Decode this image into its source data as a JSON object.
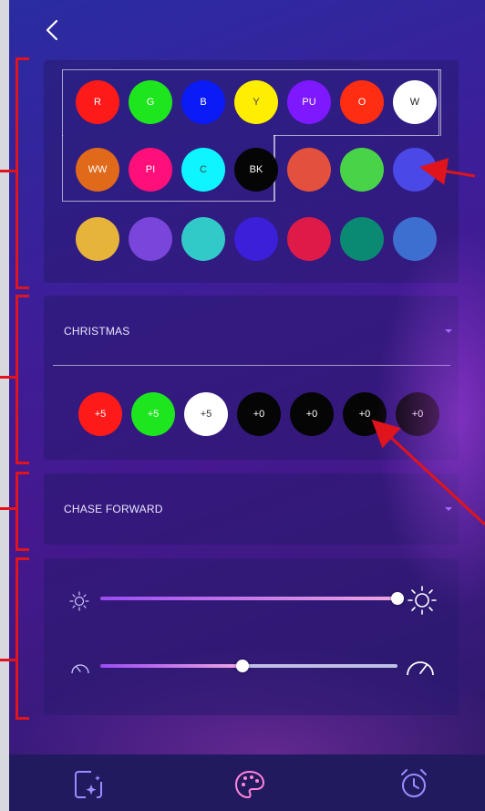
{
  "colors": {
    "row1": [
      {
        "label": "R",
        "bg": "#ff1a1a"
      },
      {
        "label": "G",
        "bg": "#1ee61e"
      },
      {
        "label": "B",
        "bg": "#0a1bf5"
      },
      {
        "label": "Y",
        "bg": "#ffee00"
      },
      {
        "label": "PU",
        "bg": "#7d18ff"
      },
      {
        "label": "O",
        "bg": "#ff2e12"
      },
      {
        "label": "W",
        "bg": "#ffffff"
      }
    ],
    "row2": [
      {
        "label": "WW",
        "bg": "#e0691a"
      },
      {
        "label": "PI",
        "bg": "#ff0f7a"
      },
      {
        "label": "C",
        "bg": "#0ff5ff"
      },
      {
        "label": "BK",
        "bg": "#050505"
      },
      {
        "label": "",
        "bg": "#e3503e"
      },
      {
        "label": "",
        "bg": "#48d348"
      },
      {
        "label": "",
        "bg": "#4a48e6"
      }
    ],
    "row3": [
      {
        "label": "",
        "bg": "#e6b43a"
      },
      {
        "label": "",
        "bg": "#7a45db"
      },
      {
        "label": "",
        "bg": "#32c9c9"
      },
      {
        "label": "",
        "bg": "#3c1fd8"
      },
      {
        "label": "",
        "bg": "#dd1a48"
      },
      {
        "label": "",
        "bg": "#0a8a72"
      },
      {
        "label": "",
        "bg": "#3d6fd0"
      }
    ]
  },
  "scene": {
    "label": "CHRISTMAS",
    "slots": [
      {
        "label": "+5",
        "bg": "#ff1a1a"
      },
      {
        "label": "+5",
        "bg": "#1ee61e"
      },
      {
        "label": "+5",
        "bg": "#ffffff"
      },
      {
        "label": "+0",
        "bg": "#050505"
      },
      {
        "label": "+0",
        "bg": "#050505"
      },
      {
        "label": "+0",
        "bg": "#050505"
      },
      {
        "label": "+0",
        "bg": "#050505"
      }
    ]
  },
  "mode": {
    "label": "CHASE FORWARD"
  },
  "sliders": {
    "brightness_fraction": 1.0,
    "speed_fraction": 0.48
  },
  "nav": {
    "items": [
      "effects-icon",
      "palette-icon",
      "alarm-clock-icon"
    ],
    "active": "palette-icon"
  },
  "accent": "#9c6cff"
}
